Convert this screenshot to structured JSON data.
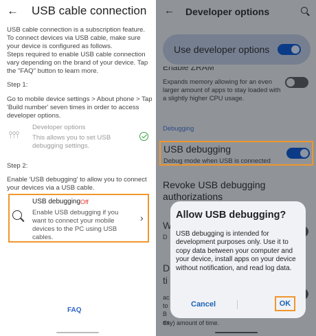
{
  "left": {
    "back_glyph": "←",
    "title": "USB cable connection",
    "intro": "USB cable connection is a subscription feature. To connect devices via USB cable, make sure your device is configured as follows.",
    "steps_note": "Steps required to enable USB cable connection vary depending on the brand of your device. Tap the \"FAQ\" button to learn more.",
    "step1_label": "Step 1:",
    "step1_text": "Go to mobile device settings > About phone > Tap 'Build number' seven times in order to access developer options.",
    "developer_options": {
      "icon": "sliders-icon",
      "icon_glyph": "⫯⫯⫯",
      "title": "Developer options",
      "description": "This allows you to set USB debugging settings.",
      "status_icon": "check-circle-icon"
    },
    "step2_label": "Step 2:",
    "step2_text": "Enable 'USB debugging' to allow you to connect your devices via a USB cable.",
    "usb_debugging": {
      "title": "USB debugging",
      "status": "Off",
      "description": "Enable USB debugging if you want to connect your mobile devices to the PC using USB cables.",
      "chevron": "›"
    },
    "faq_label": "FAQ"
  },
  "right": {
    "back_glyph": "←",
    "title": "Developer options",
    "use_developer_options": "Use developer options",
    "zram_title": "Enable ZRAM",
    "zram_desc": "Expands memory allowing for an even larger amount of apps to stay loaded with a slightly higher CPU usage.",
    "debugging_header": "Debugging",
    "usb_debugging_title": "USB debugging",
    "usb_debugging_desc": "Debug mode when USB is connected",
    "revoke": "Revoke USB debugging authorizations",
    "fragments": [
      "W",
      "D",
      "D",
      "ti",
      "ac",
      "to",
      "B",
      "ex",
      "day) amount of time."
    ],
    "toggles": {
      "use_developer_options": "on",
      "zram": "off",
      "usb_debugging": "on",
      "bottom": "off"
    }
  },
  "dialog": {
    "title": "Allow USB debugging?",
    "body": "USB debugging is intended for development purposes only. Use it to copy data between your computer and your device, install apps on your device without notification, and read log data.",
    "cancel": "Cancel",
    "ok": "OK"
  },
  "colors": {
    "highlight": "#f0962d",
    "link_blue": "#2f66c9",
    "off_red": "#e53935",
    "toggle_on": "#0b3b87"
  }
}
